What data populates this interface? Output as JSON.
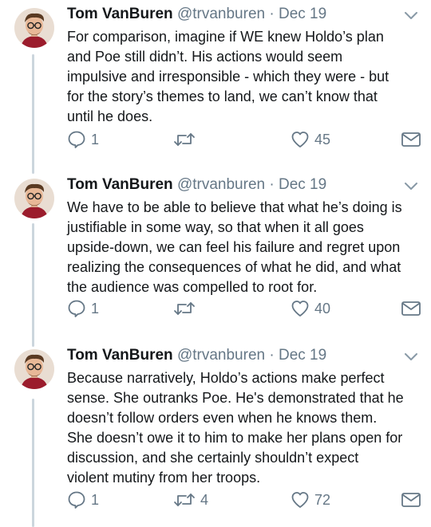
{
  "tweets": [
    {
      "name": "Tom VanBuren",
      "handle": "@trvanburen",
      "separator": "·",
      "date": "Dec 19",
      "lines": [
        "For comparison, imagine if WE knew Holdo’s plan",
        "and Poe still didn’t. His actions would seem",
        "impulsive and irresponsible - which they were - but",
        "for the story’s themes to land, we can’t know that",
        "until he does."
      ],
      "replies": "1",
      "retweets": "",
      "likes": "45"
    },
    {
      "name": "Tom VanBuren",
      "handle": "@trvanburen",
      "separator": "·",
      "date": "Dec 19",
      "lines": [
        "We have to be able to believe that what he’s doing is",
        "justifiable in some way, so that when it all goes",
        "upside-down, we can feel his failure and regret upon",
        "realizing the consequences of what he did, and what",
        "the audience was compelled to root for."
      ],
      "replies": "1",
      "retweets": "",
      "likes": "40"
    },
    {
      "name": "Tom VanBuren",
      "handle": "@trvanburen",
      "separator": "·",
      "date": "Dec 19",
      "lines": [
        "Because narratively, Holdo’s actions make perfect",
        "sense. She outranks Poe. He's demonstrated that he",
        "doesn’t follow orders even when he knows them.",
        "She doesn’t owe it to him to make her plans open for",
        "discussion, and she certainly shouldn’t expect",
        "violent mutiny from her troops."
      ],
      "replies": "1",
      "retweets": "4",
      "likes": "72"
    }
  ],
  "icons": {
    "reply": "reply-icon",
    "retweet": "retweet-icon",
    "like": "heart-icon",
    "message": "envelope-icon",
    "caret": "chevron-down-icon"
  },
  "colors": {
    "text": "#14171a",
    "secondary": "#657786",
    "thread_line": "#ccd6dd"
  }
}
